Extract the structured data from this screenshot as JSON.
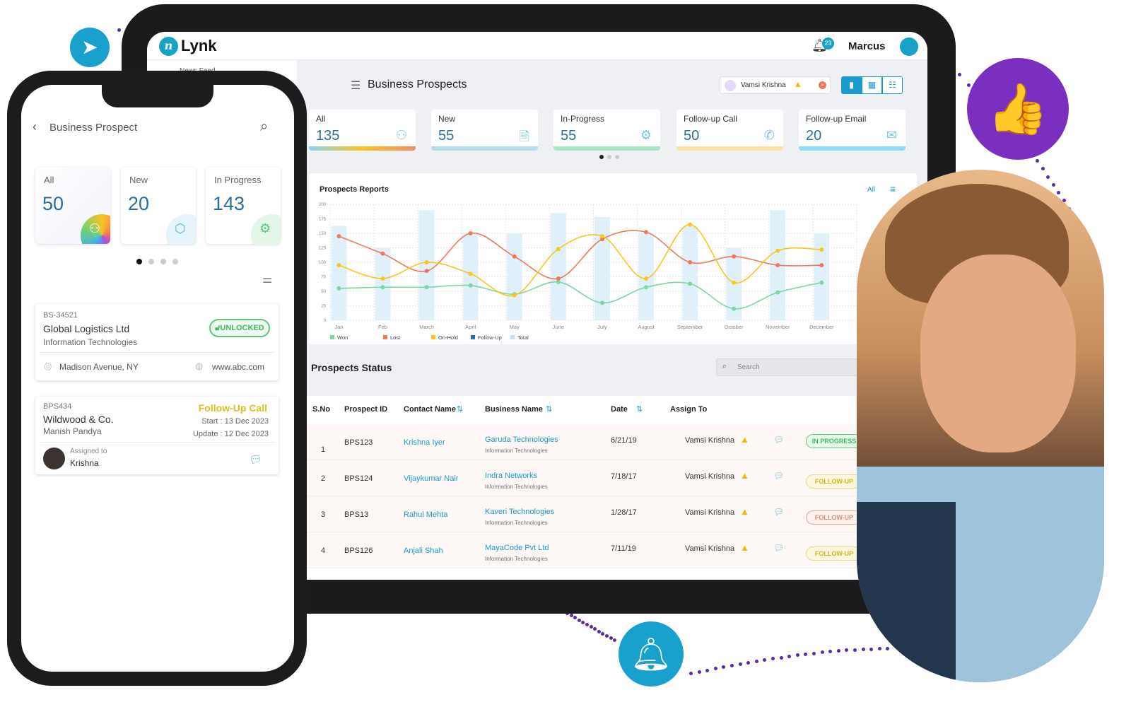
{
  "app": {
    "logo_mark": "n",
    "logo_text": "Lynk",
    "notifications": "23",
    "user": "Marcus",
    "sidebar_item": "News Feed"
  },
  "page": {
    "title": "Business Prospects",
    "filter_chip": "Vamsi Krishna"
  },
  "kpis": [
    {
      "label": "All",
      "value": "135",
      "icon": "users-icon",
      "color": "linear-gradient(90deg,#8fd3f4,#f9c61d,#f08a6b)"
    },
    {
      "label": "New",
      "value": "55",
      "icon": "document-icon",
      "color": "#b4dfea"
    },
    {
      "label": "In-Progress",
      "value": "55",
      "icon": "gear-icon",
      "color": "#a8e6c4"
    },
    {
      "label": "Follow-up Call",
      "value": "50",
      "icon": "phone-icon",
      "color": "#fbe3a7"
    },
    {
      "label": "Follow-up Email",
      "value": "20",
      "icon": "email-icon",
      "color": "#8edcf5"
    }
  ],
  "report": {
    "title": "Prospects Reports",
    "filter": "All"
  },
  "chart_data": {
    "type": "bar+line",
    "title": "Prospects Reports",
    "categories": [
      "Jan",
      "Feb",
      "March",
      "April",
      "May",
      "June",
      "July",
      "August",
      "September",
      "October",
      "November",
      "December"
    ],
    "ylim": [
      0,
      200
    ],
    "yticks": [
      0,
      25,
      50,
      75,
      100,
      125,
      150,
      175,
      200
    ],
    "grid": true,
    "legend": "bottom",
    "series": [
      {
        "name": "Won",
        "type": "line",
        "color": "#7ed6a0",
        "values": [
          55,
          57,
          57,
          60,
          45,
          66,
          30,
          57,
          63,
          20,
          48,
          65
        ]
      },
      {
        "name": "Lost",
        "type": "line",
        "color": "#f2775a",
        "values": [
          145,
          115,
          85,
          150,
          110,
          72,
          140,
          152,
          100,
          110,
          95,
          95
        ]
      },
      {
        "name": "On-Hold",
        "type": "line",
        "color": "#f9c61d",
        "values": [
          95,
          72,
          100,
          80,
          43,
          123,
          145,
          72,
          165,
          65,
          120,
          122
        ]
      },
      {
        "name": "Follow-Up",
        "type": "line",
        "color": "#2a6fa8",
        "values": []
      },
      {
        "name": "Total",
        "type": "bar",
        "color": "#dff0fb",
        "values": [
          163,
          125,
          190,
          150,
          150,
          185,
          178,
          150,
          163,
          125,
          190,
          150
        ]
      }
    ]
  },
  "status": {
    "title": "Prospects Status",
    "search_placeholder": "Search",
    "columns": [
      "S.No",
      "Prospect ID",
      "Contact Name",
      "Business Name",
      "Date",
      "Assign To"
    ],
    "rows": [
      {
        "sno": "1",
        "id": "BPS123",
        "contact": "Krishna Iyer",
        "business": "Garuda Technologies",
        "industry": "Information Technologies",
        "date": "6/21/19",
        "assignee": "Vamsi Krishna",
        "status": "IN PROGRESS"
      },
      {
        "sno": "2",
        "id": "BPS124",
        "contact": "Vijaykumar Nair",
        "business": "Indra Networks",
        "industry": "Information Technologies",
        "date": "7/18/17",
        "assignee": "Vamsi Krishna",
        "status": "FOLLOW-UP"
      },
      {
        "sno": "3",
        "id": "BPS13",
        "contact": "Rahul Mehta",
        "business": "Kaveri Technologies",
        "industry": "Information Technologies",
        "date": "1/28/17",
        "assignee": "Vamsi Krishna",
        "status": "FOLLOW-UP"
      },
      {
        "sno": "4",
        "id": "BPS126",
        "contact": "Anjali Shah",
        "business": "MayaCode Pvt Ltd",
        "industry": "Information Technologies",
        "date": "7/11/19",
        "assignee": "Vamsi Krishna",
        "status": "FOLLOW-UP"
      }
    ]
  },
  "mobile": {
    "title": "Business Prospect",
    "kpis": [
      {
        "label": "All",
        "value": "50"
      },
      {
        "label": "New",
        "value": "20"
      },
      {
        "label": "In Progress",
        "value": "143"
      }
    ],
    "card1": {
      "id": "BS-34521",
      "name": "Global Logistics Ltd",
      "industry": "Information Technologies",
      "badge": "UNLOCKED",
      "location": "Madison Avenue, NY",
      "website": "www.abc.com"
    },
    "card2": {
      "id": "BPS434",
      "name": "Wildwood & Co.",
      "contact": "Manish Pandya",
      "status": "Follow-Up Call",
      "start": "Start : 13 Dec 2023",
      "update": "Update : 12 Dec 2023",
      "assigned_label": "Assigned to",
      "assignee": "Krishna"
    }
  }
}
